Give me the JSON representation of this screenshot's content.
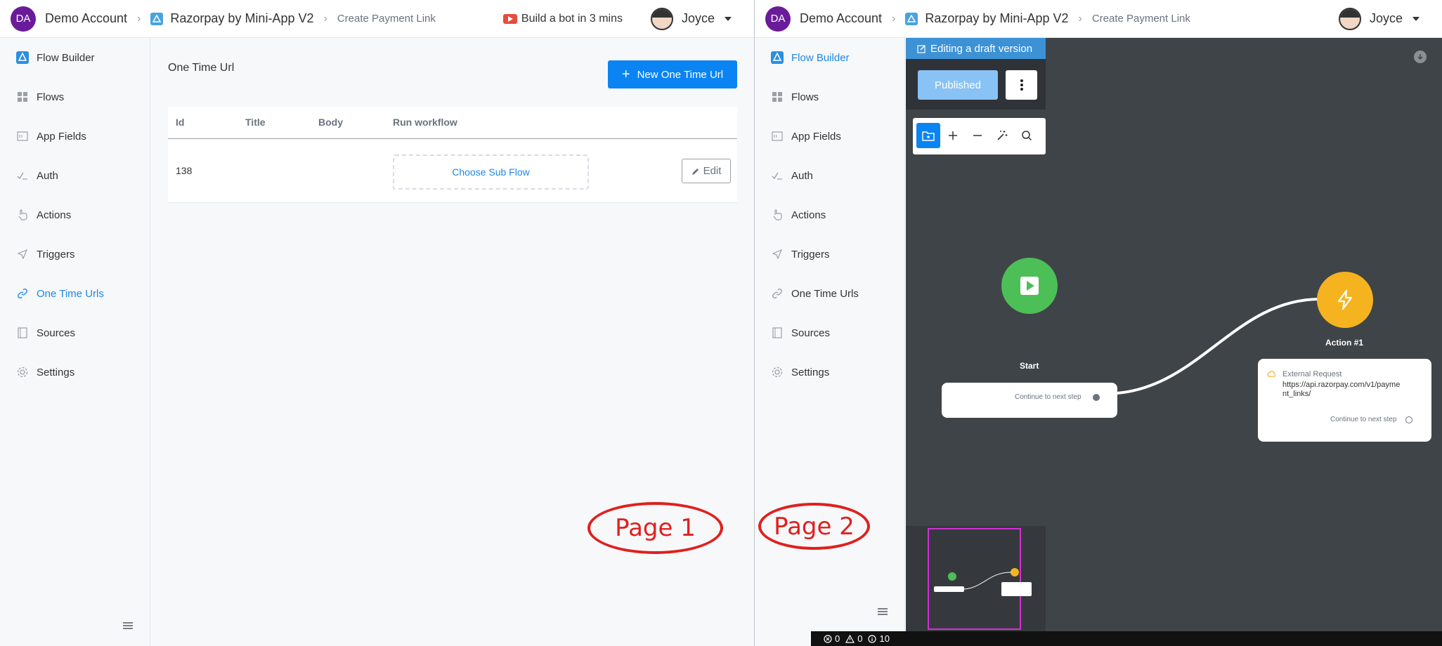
{
  "header": {
    "avatar_initials": "DA",
    "account_name": "Demo Account",
    "app_name": "Razorpay by Mini-App V2",
    "breadcrumb": "Create Payment Link",
    "promo_label": "Build a bot in 3 mins",
    "user_name": "Joyce"
  },
  "sidebar": {
    "items": [
      {
        "label": "Flow Builder",
        "icon": "flow-builder-icon"
      },
      {
        "label": "Flows",
        "icon": "grid-icon"
      },
      {
        "label": "App Fields",
        "icon": "fields-icon"
      },
      {
        "label": "Auth",
        "icon": "auth-icon"
      },
      {
        "label": "Actions",
        "icon": "hand-pointer-icon"
      },
      {
        "label": "Triggers",
        "icon": "send-icon"
      },
      {
        "label": "One Time Urls",
        "icon": "link-icon"
      },
      {
        "label": "Sources",
        "icon": "book-icon"
      },
      {
        "label": "Settings",
        "icon": "gear-icon"
      }
    ],
    "page1_active": "One Time Urls",
    "page2_active": "Flow Builder"
  },
  "page1": {
    "title": "One Time Url",
    "new_button": "New One Time Url",
    "columns": [
      "Id",
      "Title",
      "Body",
      "Run workflow"
    ],
    "row": {
      "id": "138",
      "choose_label": "Choose Sub Flow",
      "edit_label": "Edit"
    },
    "annotation": "Page 1"
  },
  "page2": {
    "draft_banner": "Editing a draft version",
    "published_label": "Published",
    "start_label": "Start",
    "start_continue": "Continue to next step",
    "action_label": "Action #1",
    "action_type": "External Request",
    "action_url": "https://api.razorpay.com/v1/payment_links/",
    "action_continue": "Continue to next step",
    "annotation": "Page 2",
    "status": {
      "errors": "0",
      "warnings": "0",
      "info": "10"
    }
  },
  "colors": {
    "primary": "#0b84f3",
    "start_node": "#4cbf56",
    "action_node": "#f5b41f",
    "canvas": "#3f4448",
    "annotation": "#e0201d"
  }
}
